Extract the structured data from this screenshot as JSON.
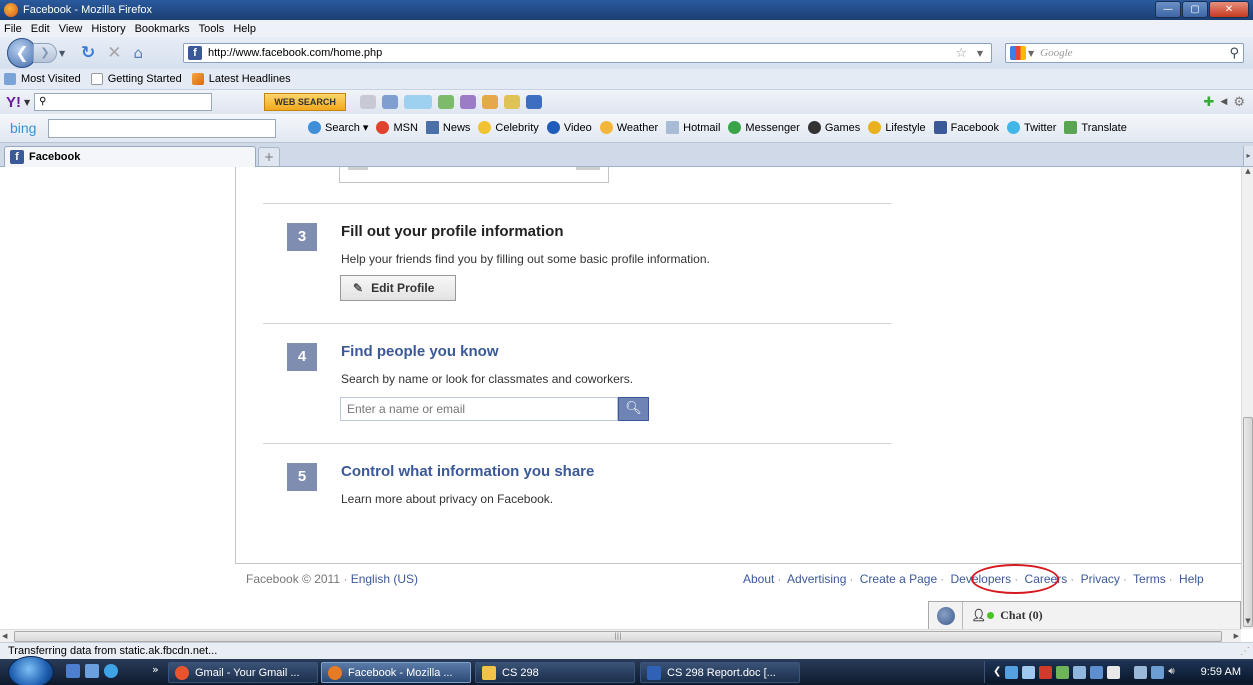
{
  "window": {
    "title": "Facebook - Mozilla Firefox",
    "buttons": {
      "minimize": "—",
      "maximize": "▢",
      "close": "✕"
    }
  },
  "menu": [
    "File",
    "Edit",
    "View",
    "History",
    "Bookmarks",
    "Tools",
    "Help"
  ],
  "nav": {
    "url": "http://www.facebook.com/home.php",
    "search_placeholder": "Google"
  },
  "bookmarks": [
    "Most Visited",
    "Getting Started",
    "Latest Headlines"
  ],
  "yahoo_toolbar": {
    "logo": "Y!",
    "search_button": "WEB SEARCH"
  },
  "bing_toolbar": {
    "logo": "bing",
    "links": [
      "Search",
      "MSN",
      "News",
      "Celebrity",
      "Video",
      "Weather",
      "Hotmail",
      "Messenger",
      "Games",
      "Lifestyle",
      "Facebook",
      "Twitter",
      "Translate"
    ]
  },
  "tabs": [
    {
      "label": "Facebook"
    }
  ],
  "content": {
    "steps": [
      {
        "number": "3",
        "title": "Fill out your profile information",
        "description": "Help your friends find you by filling out some basic profile information.",
        "button": "Edit Profile"
      },
      {
        "number": "4",
        "title": "Find people you know",
        "description": "Search by name or look for classmates and coworkers.",
        "input_placeholder": "Enter a name or email"
      },
      {
        "number": "5",
        "title": "Control what information you share",
        "description": "Learn more about privacy on Facebook."
      }
    ],
    "footer": {
      "copyright": "Facebook © 2011",
      "language": "English (US)",
      "links": [
        "About",
        "Advertising",
        "Create a Page",
        "Developers",
        "Careers",
        "Privacy",
        "Terms",
        "Help"
      ]
    },
    "chat": {
      "label": "Chat",
      "count": "(0)"
    }
  },
  "statusbar": {
    "text": "Transferring data from static.ak.fbcdn.net..."
  },
  "taskbar": {
    "tasks": [
      "Gmail - Your Gmail ...",
      "Facebook - Mozilla ...",
      "CS 298",
      "CS 298 Report.doc [..."
    ],
    "clock": "9:59 AM"
  },
  "colors": {
    "facebook_blue": "#3b5998",
    "step_badge": "#7e8db0",
    "highlight_circle": "#d6181f"
  }
}
